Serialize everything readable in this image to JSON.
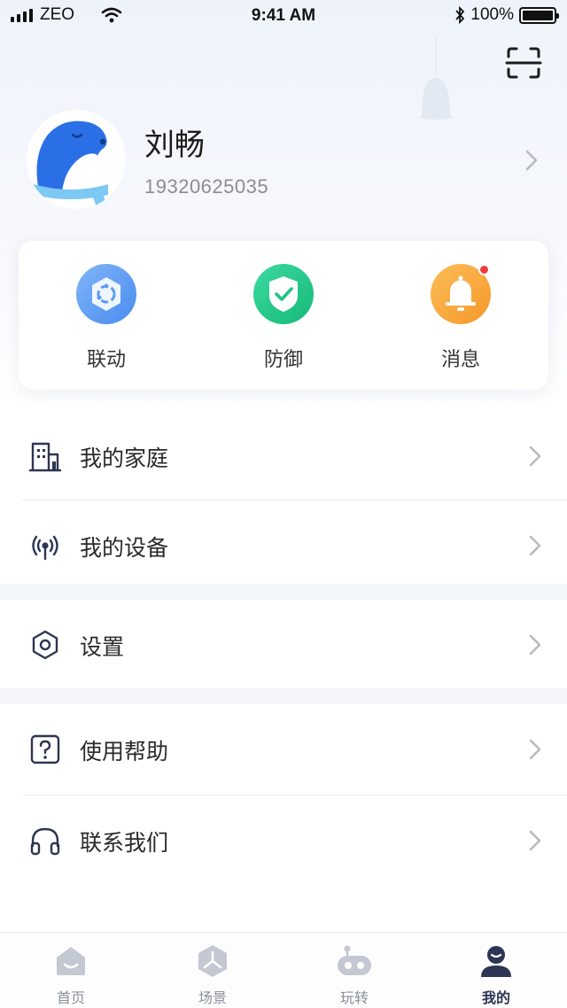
{
  "status_bar": {
    "carrier": "ZEO",
    "time": "9:41 AM",
    "battery": "100%"
  },
  "profile": {
    "name": "刘畅",
    "phone": "19320625035"
  },
  "quick_actions": [
    {
      "label": "联动",
      "icon": "linkage-icon",
      "color": "#5b9cf2"
    },
    {
      "label": "防御",
      "icon": "shield-icon",
      "color": "#23c98a"
    },
    {
      "label": "消息",
      "icon": "bell-icon",
      "color": "#f8a93a",
      "has_badge": true
    }
  ],
  "menu": [
    {
      "label": "我的家庭",
      "icon": "building-icon"
    },
    {
      "label": "我的设备",
      "icon": "device-icon"
    },
    {
      "label": "设置",
      "icon": "settings-icon"
    },
    {
      "label": "使用帮助",
      "icon": "help-icon"
    },
    {
      "label": "联系我们",
      "icon": "headphones-icon"
    }
  ],
  "tab_bar": {
    "tabs": [
      {
        "label": "首页",
        "icon": "home-icon"
      },
      {
        "label": "场景",
        "icon": "scene-icon"
      },
      {
        "label": "玩转",
        "icon": "robot-icon"
      },
      {
        "label": "我的",
        "icon": "profile-icon"
      }
    ],
    "active_tab": "我的"
  },
  "colors": {
    "accent_dark": "#2d3552",
    "badge_red": "#f23c3c",
    "inactive_tab": "#c4c8d2"
  }
}
